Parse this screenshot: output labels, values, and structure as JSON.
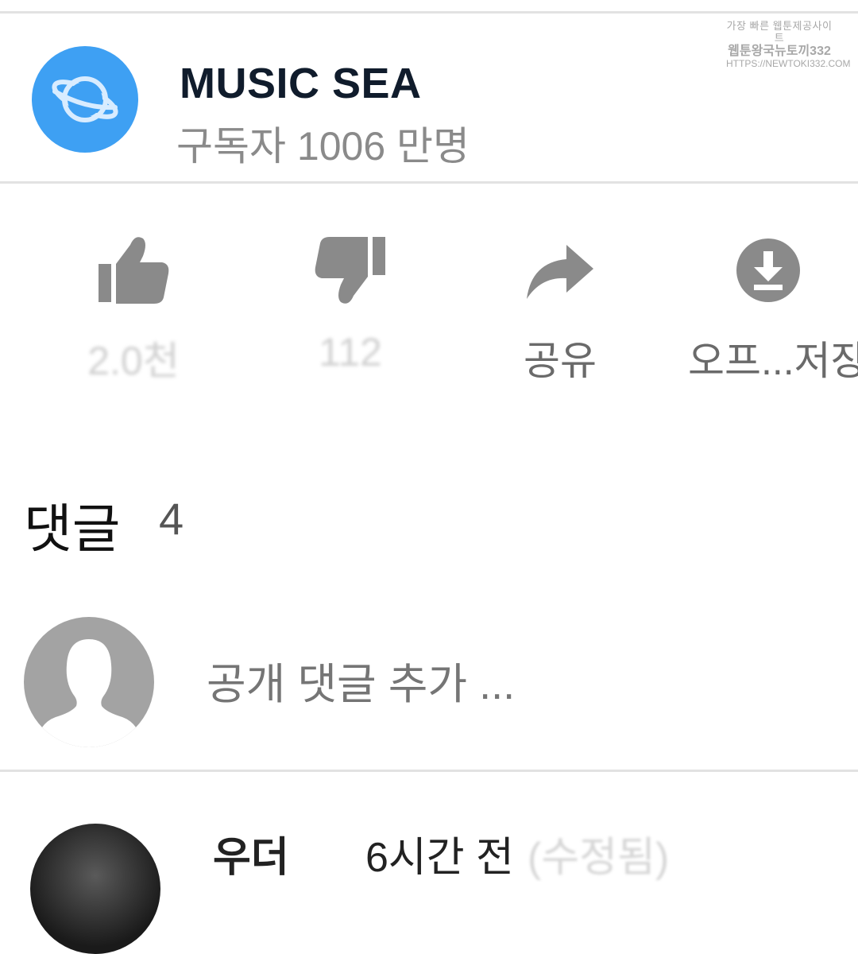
{
  "watermark": {
    "line1": "가장 빠른 웹툰제공사이트",
    "line2": "웹툰왕국뉴토끼332",
    "line3": "HTTPS://NEWTOKI332.COM"
  },
  "channel": {
    "name": "MUSIC SEA",
    "subscribers": "구독자 1006 만명",
    "avatar_icon": "planet-icon",
    "avatar_color": "#3ea0f3"
  },
  "actions": {
    "like": {
      "label": "2.0천",
      "icon": "thumbs-up-icon"
    },
    "dislike": {
      "label": "112",
      "icon": "thumbs-down-icon"
    },
    "share": {
      "label": "공유",
      "icon": "share-arrow-icon"
    },
    "save": {
      "label": "오프...저장",
      "icon": "download-icon"
    }
  },
  "comments": {
    "title": "댓글",
    "count": "4",
    "input_placeholder": "공개 댓글 추가 ..."
  },
  "first_comment": {
    "author": "우더",
    "time": "6시간 전",
    "tag": "(수정됨)"
  }
}
